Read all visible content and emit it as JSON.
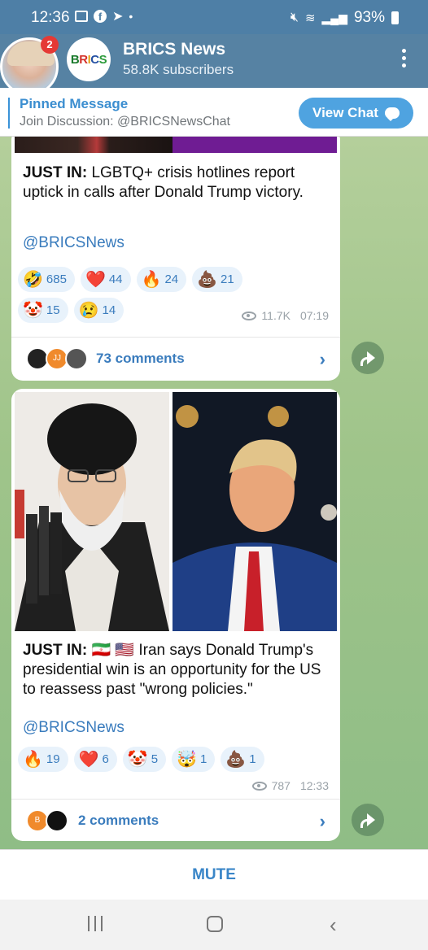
{
  "status_bar": {
    "time": "12:36",
    "battery": "93%"
  },
  "header": {
    "notification_count": "2",
    "logo_text": [
      "B",
      "R",
      "I",
      "C",
      "S"
    ],
    "title": "BRICS News",
    "subscribers": "58.8K subscribers"
  },
  "pinned": {
    "title": "Pinned Message",
    "subtitle": "Join Discussion: @BRICSNewsChat",
    "button": "View Chat"
  },
  "posts": [
    {
      "prefix": "JUST IN:",
      "text": " LGBTQ+ crisis hotlines report uptick in calls after Donald Trump victory.",
      "link": "@BRICSNews",
      "reactions": [
        {
          "emoji": "🤣",
          "count": "685"
        },
        {
          "emoji": "❤️",
          "count": "44"
        },
        {
          "emoji": "🔥",
          "count": "24"
        },
        {
          "emoji": "💩",
          "count": "21"
        },
        {
          "emoji": "🤡",
          "count": "15"
        },
        {
          "emoji": "😢",
          "count": "14"
        }
      ],
      "views": "11.7K",
      "time": "07:19",
      "comments": "73 comments",
      "comment_avatars": [
        "",
        "JJ",
        ""
      ]
    },
    {
      "prefix": "JUST IN:",
      "flags": "🇮🇷 🇺🇸",
      "text": " Iran says Donald Trump's presidential win is an opportunity for the US to reassess past \"wrong policies.\"",
      "link": "@BRICSNews",
      "reactions": [
        {
          "emoji": "🔥",
          "count": "19"
        },
        {
          "emoji": "❤️",
          "count": "6"
        },
        {
          "emoji": "🤡",
          "count": "5"
        },
        {
          "emoji": "🤯",
          "count": "1"
        },
        {
          "emoji": "💩",
          "count": "1"
        }
      ],
      "views": "787",
      "time": "12:33",
      "comments": "2 comments",
      "comment_avatars": [
        "B",
        ""
      ]
    }
  ],
  "bottom": {
    "mute": "MUTE"
  }
}
